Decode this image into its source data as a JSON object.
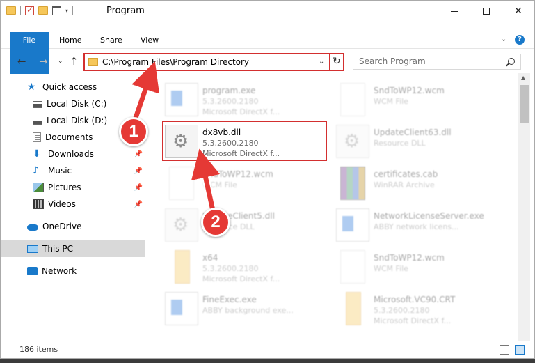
{
  "window": {
    "title": "Program"
  },
  "ribbon": {
    "tabs": [
      "File",
      "Home",
      "Share",
      "View"
    ]
  },
  "address": {
    "path": "C:\\Program Files\\Program Directory"
  },
  "search": {
    "placeholder": "Search Program"
  },
  "sidebar": {
    "items": [
      {
        "label": "Quick access",
        "icon": "star-icon"
      },
      {
        "label": "Local Disk (C:)",
        "icon": "disk-icon"
      },
      {
        "label": "Local Disk (D:)",
        "icon": "disk-icon"
      },
      {
        "label": "Documents",
        "icon": "documents-icon"
      },
      {
        "label": "Downloads",
        "icon": "download-icon"
      },
      {
        "label": "Music",
        "icon": "music-icon"
      },
      {
        "label": "Pictures",
        "icon": "pictures-icon"
      },
      {
        "label": "Videos",
        "icon": "videos-icon"
      },
      {
        "label": "OneDrive",
        "icon": "cloud-icon"
      },
      {
        "label": "This PC",
        "icon": "pc-icon"
      },
      {
        "label": "Network",
        "icon": "network-icon"
      }
    ]
  },
  "files": {
    "left": [
      {
        "name": "program.exe",
        "line1": "5.3.2600.2180",
        "line2": "Microsoft DirectX f..."
      },
      {
        "name": "dx8vb.dll",
        "line1": "5.3.2600.2180",
        "line2": "Microsoft DirectX f..."
      },
      {
        "name": "SndToWP12.wcm",
        "line1": "WCM File",
        "line2": ""
      },
      {
        "name": "UpdateClient5.dll",
        "line1": "Resource DLL",
        "line2": ""
      },
      {
        "name": "x64",
        "line1": "5.3.2600.2180",
        "line2": "Microsoft DirectX f..."
      },
      {
        "name": "FineExec.exe",
        "line1": "ABBY background exe...",
        "line2": ""
      }
    ],
    "right": [
      {
        "name": "SndToWP12.wcm",
        "line1": "WCM File",
        "line2": ""
      },
      {
        "name": "UpdateClient63.dll",
        "line1": "Resource DLL",
        "line2": ""
      },
      {
        "name": "certificates.cab",
        "line1": "WinRAR Archive",
        "line2": ""
      },
      {
        "name": "NetworkLicenseServer.exe",
        "line1": "ABBY network licens...",
        "line2": ""
      },
      {
        "name": "SndToWP12.wcm",
        "line1": "WCM File",
        "line2": ""
      },
      {
        "name": "Microsoft.VC90.CRT",
        "line1": "5.3.2600.2180",
        "line2": "Microsoft DirectX f..."
      }
    ]
  },
  "annotations": {
    "step1": "1",
    "step2": "2"
  },
  "status": {
    "count": "186 items"
  },
  "colors": {
    "accent": "#1979ca",
    "annotation": "#d32f2f"
  }
}
